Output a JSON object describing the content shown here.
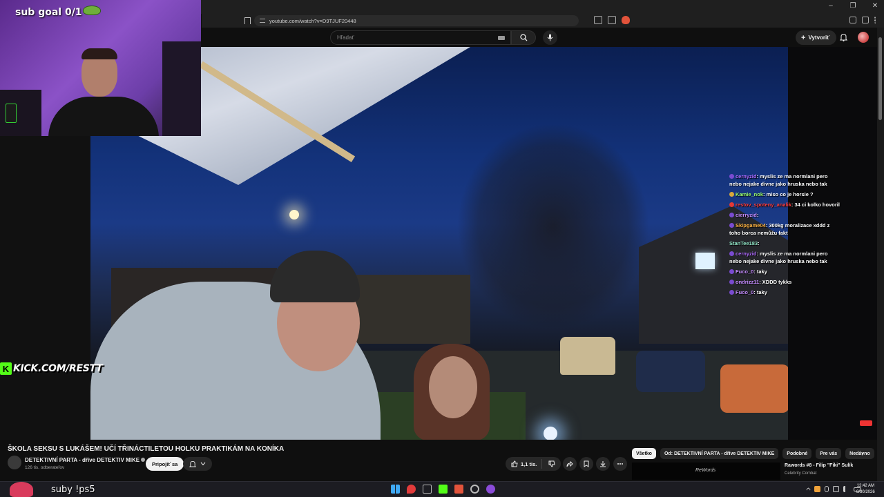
{
  "browser": {
    "url": "youtube.com/watch?v=D9TJUF20448"
  },
  "youtube": {
    "search_placeholder": "Hľadať",
    "create_label": "Vytvoriť"
  },
  "stream_overlay": {
    "sub_goal": "sub goal 0/1",
    "kick_logo": "K",
    "kick_text": "KICK.COM/RESTT",
    "bottom_text": "suby !ps5"
  },
  "chat": [
    {
      "user": "cernyzid",
      "user_color": "#b06bff",
      "badge_color": "#7a4bd1",
      "text": "myslis ze ma normlani pero nebo nejake divne jako hruska nebo tak"
    },
    {
      "user": "Kamie_nok",
      "user_color": "#9cff6b",
      "badge_color": "#d9a83a",
      "text": "miso co je horsie ?"
    },
    {
      "user": "restov_spoteny_analik",
      "user_color": "#ff3b3b",
      "badge_color": "#e53935",
      "text": "34 ci kolko hovoril"
    },
    {
      "user": "cierryzid",
      "user_color": "#c58cff",
      "badge_color": "#7a4bd1",
      "text": ""
    },
    {
      "user": "Skipgame04",
      "user_color": "#ffb340",
      "badge_color": "#7a4bd1",
      "text": "300kg moralizace xddd z toho borca nemůžu fakt"
    },
    {
      "user": "StanTee183",
      "user_color": "#8fe3c4",
      "badge_color": "",
      "text": ""
    },
    {
      "user": "cernyzid",
      "user_color": "#b06bff",
      "badge_color": "#7a4bd1",
      "text": "myslis ze ma normlani pero nebo nejake divne jako hruska nebo tak"
    },
    {
      "user": "Fuco_0",
      "user_color": "#c58cff",
      "badge_color": "#7a4bd1",
      "text": "taky"
    },
    {
      "user": "ondrizz11",
      "user_color": "#c58cff",
      "badge_color": "#7a4bd1",
      "text": "XDDD tykks"
    },
    {
      "user": "Fuco_0",
      "user_color": "#c58cff",
      "badge_color": "#7a4bd1",
      "text": "taky"
    }
  ],
  "video": {
    "title": "ŠKOLA SEKSU S LUKÁŠEM! UČÍ TŘINÁCTILETOU HOLKU PRAKTIKÁM NA KONÍKA",
    "channel": "DETEKTIVNÍ PARTA - dříve DETEKTIV MIKE",
    "subscribers": "126 tis. odberateľov",
    "join_label": "Pripojiť sa",
    "likes": "1,1 tis."
  },
  "chips": [
    "Všetko",
    "Od: DETEKTIVNÍ PARTA - dříve DETEKTIV MIKE",
    "Podobné",
    "Pre vás",
    "Nedávno"
  ],
  "recommendation": {
    "thumb_logo": "ReWords",
    "title": "Rawords #8 - Filip \"Fiki\" Sulík",
    "channel": "Celebrity Combat"
  },
  "taskbar": {
    "time": "12:42 AM",
    "date": "8/30/2026"
  },
  "colors": {
    "yt_bg": "#0f0f0f",
    "kick_green": "#53fc18",
    "chip_active": "#f1f1f1"
  }
}
